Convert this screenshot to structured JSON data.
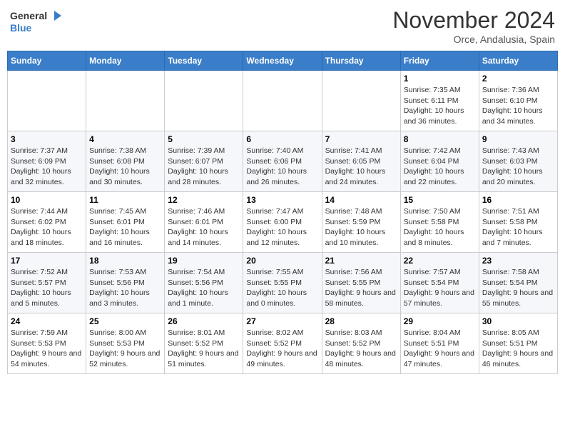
{
  "header": {
    "logo_general": "General",
    "logo_blue": "Blue",
    "month": "November 2024",
    "location": "Orce, Andalusia, Spain"
  },
  "days_of_week": [
    "Sunday",
    "Monday",
    "Tuesday",
    "Wednesday",
    "Thursday",
    "Friday",
    "Saturday"
  ],
  "weeks": [
    [
      {
        "day": "",
        "info": ""
      },
      {
        "day": "",
        "info": ""
      },
      {
        "day": "",
        "info": ""
      },
      {
        "day": "",
        "info": ""
      },
      {
        "day": "",
        "info": ""
      },
      {
        "day": "1",
        "info": "Sunrise: 7:35 AM\nSunset: 6:11 PM\nDaylight: 10 hours and 36 minutes."
      },
      {
        "day": "2",
        "info": "Sunrise: 7:36 AM\nSunset: 6:10 PM\nDaylight: 10 hours and 34 minutes."
      }
    ],
    [
      {
        "day": "3",
        "info": "Sunrise: 7:37 AM\nSunset: 6:09 PM\nDaylight: 10 hours and 32 minutes."
      },
      {
        "day": "4",
        "info": "Sunrise: 7:38 AM\nSunset: 6:08 PM\nDaylight: 10 hours and 30 minutes."
      },
      {
        "day": "5",
        "info": "Sunrise: 7:39 AM\nSunset: 6:07 PM\nDaylight: 10 hours and 28 minutes."
      },
      {
        "day": "6",
        "info": "Sunrise: 7:40 AM\nSunset: 6:06 PM\nDaylight: 10 hours and 26 minutes."
      },
      {
        "day": "7",
        "info": "Sunrise: 7:41 AM\nSunset: 6:05 PM\nDaylight: 10 hours and 24 minutes."
      },
      {
        "day": "8",
        "info": "Sunrise: 7:42 AM\nSunset: 6:04 PM\nDaylight: 10 hours and 22 minutes."
      },
      {
        "day": "9",
        "info": "Sunrise: 7:43 AM\nSunset: 6:03 PM\nDaylight: 10 hours and 20 minutes."
      }
    ],
    [
      {
        "day": "10",
        "info": "Sunrise: 7:44 AM\nSunset: 6:02 PM\nDaylight: 10 hours and 18 minutes."
      },
      {
        "day": "11",
        "info": "Sunrise: 7:45 AM\nSunset: 6:01 PM\nDaylight: 10 hours and 16 minutes."
      },
      {
        "day": "12",
        "info": "Sunrise: 7:46 AM\nSunset: 6:01 PM\nDaylight: 10 hours and 14 minutes."
      },
      {
        "day": "13",
        "info": "Sunrise: 7:47 AM\nSunset: 6:00 PM\nDaylight: 10 hours and 12 minutes."
      },
      {
        "day": "14",
        "info": "Sunrise: 7:48 AM\nSunset: 5:59 PM\nDaylight: 10 hours and 10 minutes."
      },
      {
        "day": "15",
        "info": "Sunrise: 7:50 AM\nSunset: 5:58 PM\nDaylight: 10 hours and 8 minutes."
      },
      {
        "day": "16",
        "info": "Sunrise: 7:51 AM\nSunset: 5:58 PM\nDaylight: 10 hours and 7 minutes."
      }
    ],
    [
      {
        "day": "17",
        "info": "Sunrise: 7:52 AM\nSunset: 5:57 PM\nDaylight: 10 hours and 5 minutes."
      },
      {
        "day": "18",
        "info": "Sunrise: 7:53 AM\nSunset: 5:56 PM\nDaylight: 10 hours and 3 minutes."
      },
      {
        "day": "19",
        "info": "Sunrise: 7:54 AM\nSunset: 5:56 PM\nDaylight: 10 hours and 1 minute."
      },
      {
        "day": "20",
        "info": "Sunrise: 7:55 AM\nSunset: 5:55 PM\nDaylight: 10 hours and 0 minutes."
      },
      {
        "day": "21",
        "info": "Sunrise: 7:56 AM\nSunset: 5:55 PM\nDaylight: 9 hours and 58 minutes."
      },
      {
        "day": "22",
        "info": "Sunrise: 7:57 AM\nSunset: 5:54 PM\nDaylight: 9 hours and 57 minutes."
      },
      {
        "day": "23",
        "info": "Sunrise: 7:58 AM\nSunset: 5:54 PM\nDaylight: 9 hours and 55 minutes."
      }
    ],
    [
      {
        "day": "24",
        "info": "Sunrise: 7:59 AM\nSunset: 5:53 PM\nDaylight: 9 hours and 54 minutes."
      },
      {
        "day": "25",
        "info": "Sunrise: 8:00 AM\nSunset: 5:53 PM\nDaylight: 9 hours and 52 minutes."
      },
      {
        "day": "26",
        "info": "Sunrise: 8:01 AM\nSunset: 5:52 PM\nDaylight: 9 hours and 51 minutes."
      },
      {
        "day": "27",
        "info": "Sunrise: 8:02 AM\nSunset: 5:52 PM\nDaylight: 9 hours and 49 minutes."
      },
      {
        "day": "28",
        "info": "Sunrise: 8:03 AM\nSunset: 5:52 PM\nDaylight: 9 hours and 48 minutes."
      },
      {
        "day": "29",
        "info": "Sunrise: 8:04 AM\nSunset: 5:51 PM\nDaylight: 9 hours and 47 minutes."
      },
      {
        "day": "30",
        "info": "Sunrise: 8:05 AM\nSunset: 5:51 PM\nDaylight: 9 hours and 46 minutes."
      }
    ]
  ]
}
